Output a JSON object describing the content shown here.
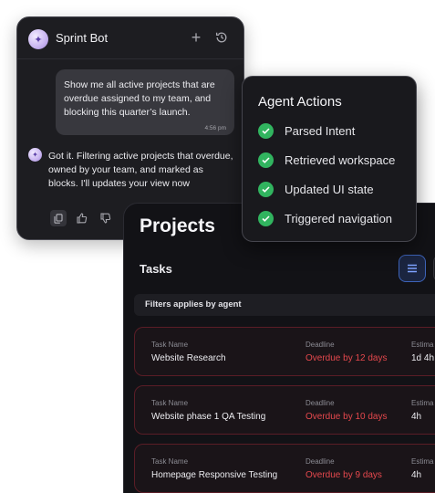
{
  "chat": {
    "title": "Sprint Bot",
    "user_message": "Show me all active projects that are overdue assigned to my team, and blocking this quarter’s launch.",
    "user_time": "4:56 pm",
    "bot_message": "Got it. Filtering active projects that overdue, owned by your team, and marked as blocks. I'll updates your view now",
    "icons": [
      "sparkle-icon",
      "plus-icon",
      "history-icon",
      "copy-icon",
      "thumbs-up-icon",
      "thumbs-down-icon"
    ]
  },
  "agent": {
    "title": "Agent Actions",
    "steps": [
      "Parsed Intent",
      "Retrieved workspace",
      "Updated UI state",
      "Triggered navigation"
    ],
    "status_color": "#31b45f"
  },
  "projects": {
    "title": "Projects",
    "tasks_label": "Tasks",
    "filters_label": "Filters applies by agent",
    "columns": [
      "Task Name",
      "Deadline",
      "Estima"
    ],
    "rows": [
      {
        "name": "Website Research",
        "deadline": "Overdue by 12 days",
        "estimate": "1d 4h"
      },
      {
        "name": "Website phase 1 QA Testing",
        "deadline": "Overdue by 10 days",
        "estimate": "4h"
      },
      {
        "name": "Homepage Responsive Testing",
        "deadline": "Overdue by 9 days",
        "estimate": "4h"
      }
    ],
    "overdue_color": "#e5484d"
  }
}
